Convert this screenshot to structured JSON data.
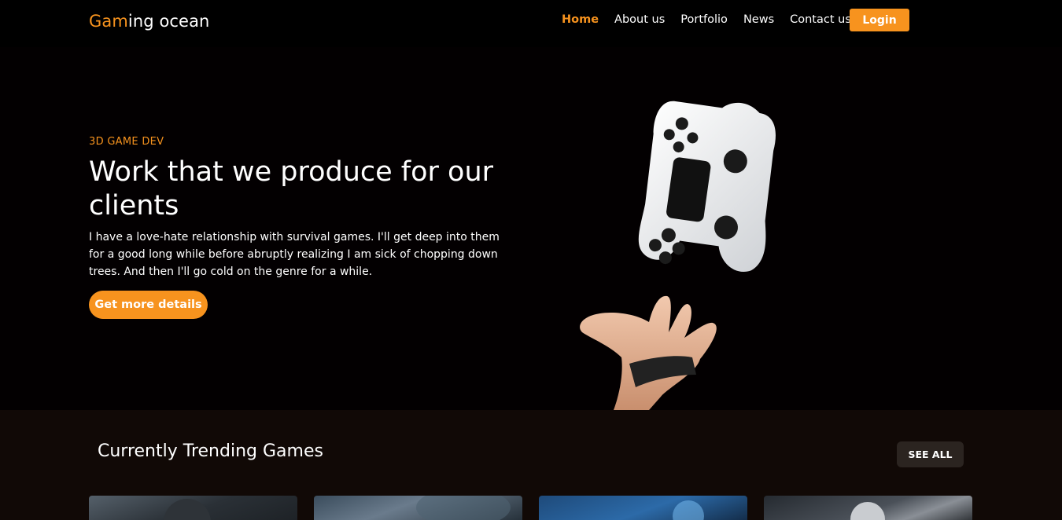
{
  "nav": {
    "logo_accent": "Gam",
    "logo_rest": "ing ocean",
    "items": [
      {
        "label": "Home",
        "active": true
      },
      {
        "label": "About us",
        "active": false
      },
      {
        "label": "Portfolio",
        "active": false
      },
      {
        "label": "News",
        "active": false
      },
      {
        "label": "Contact us",
        "active": false
      }
    ],
    "login_label": "Login"
  },
  "hero": {
    "eyebrow": "3D GAME DEV",
    "headline": "Work that we produce for our clients",
    "description": "I have a love-hate relationship with survival games. I'll get deep into them for a good long while before abruptly realizing I am sick of chopping down trees. And then I'll go cold on the genre for a while.",
    "cta_label": "Get more details",
    "image_icon": "gamepad-floating-over-hand"
  },
  "trending": {
    "title": "Currently Trending Games",
    "see_all_label": "SEE ALL",
    "cards": [
      {
        "image": "game-thumbnail-1"
      },
      {
        "image": "game-thumbnail-2"
      },
      {
        "image": "game-thumbnail-3"
      },
      {
        "image": "game-thumbnail-4"
      }
    ]
  },
  "colors": {
    "accent": "#f7931e",
    "background": "#000000",
    "section_background": "#110906"
  }
}
